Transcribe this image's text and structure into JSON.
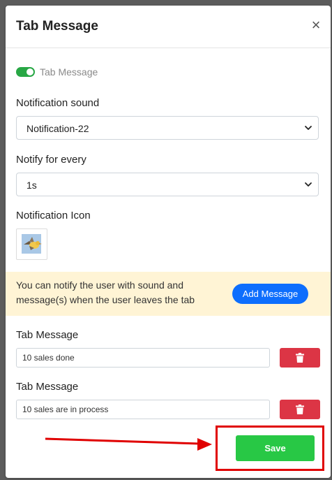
{
  "modal": {
    "title": "Tab Message",
    "close_symbol": "×"
  },
  "toggle": {
    "label": "Tab Message",
    "enabled": true,
    "color": "#28a745"
  },
  "notification_sound": {
    "label": "Notification sound",
    "value": "Notification-22"
  },
  "notify_every": {
    "label": "Notify for every",
    "value": "1s"
  },
  "notification_icon": {
    "label": "Notification Icon",
    "icon": "bird-icon"
  },
  "banner": {
    "text": "You can notify the user with sound and message(s) when the user leaves the tab",
    "button_label": "Add Message",
    "background": "#fff4d5"
  },
  "messages": [
    {
      "label": "Tab Message",
      "value": "10 sales done"
    },
    {
      "label": "Tab Message",
      "value": "10 sales are in process"
    }
  ],
  "save_label": "Save",
  "colors": {
    "primary": "#0d6efd",
    "danger": "#dc3545",
    "success": "#28c845",
    "annotation": "#e00000"
  }
}
